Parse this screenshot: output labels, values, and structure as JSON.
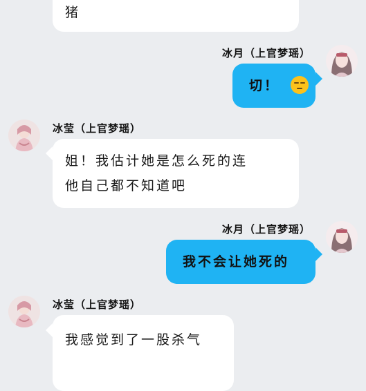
{
  "colors": {
    "background": "#ebedf0",
    "incoming_bubble": "#ffffff",
    "outgoing_bubble": "#1fb3f3"
  },
  "messages": [
    {
      "direction": "incoming",
      "sender": "",
      "text": "猪"
    },
    {
      "direction": "outgoing",
      "sender": "冰月（上官梦瑶）",
      "text": "切！",
      "emoji": "unamused-face-icon"
    },
    {
      "direction": "incoming",
      "sender": "冰莹（上官梦瑶）",
      "lines": [
        "姐！我估计她是怎么死的连",
        "他自己都不知道吧"
      ]
    },
    {
      "direction": "outgoing",
      "sender": "冰月（上官梦瑶）",
      "text": "我不会让她死的"
    },
    {
      "direction": "incoming",
      "sender": "冰莹（上官梦瑶）",
      "text": "我感觉到了一股杀气"
    }
  ]
}
